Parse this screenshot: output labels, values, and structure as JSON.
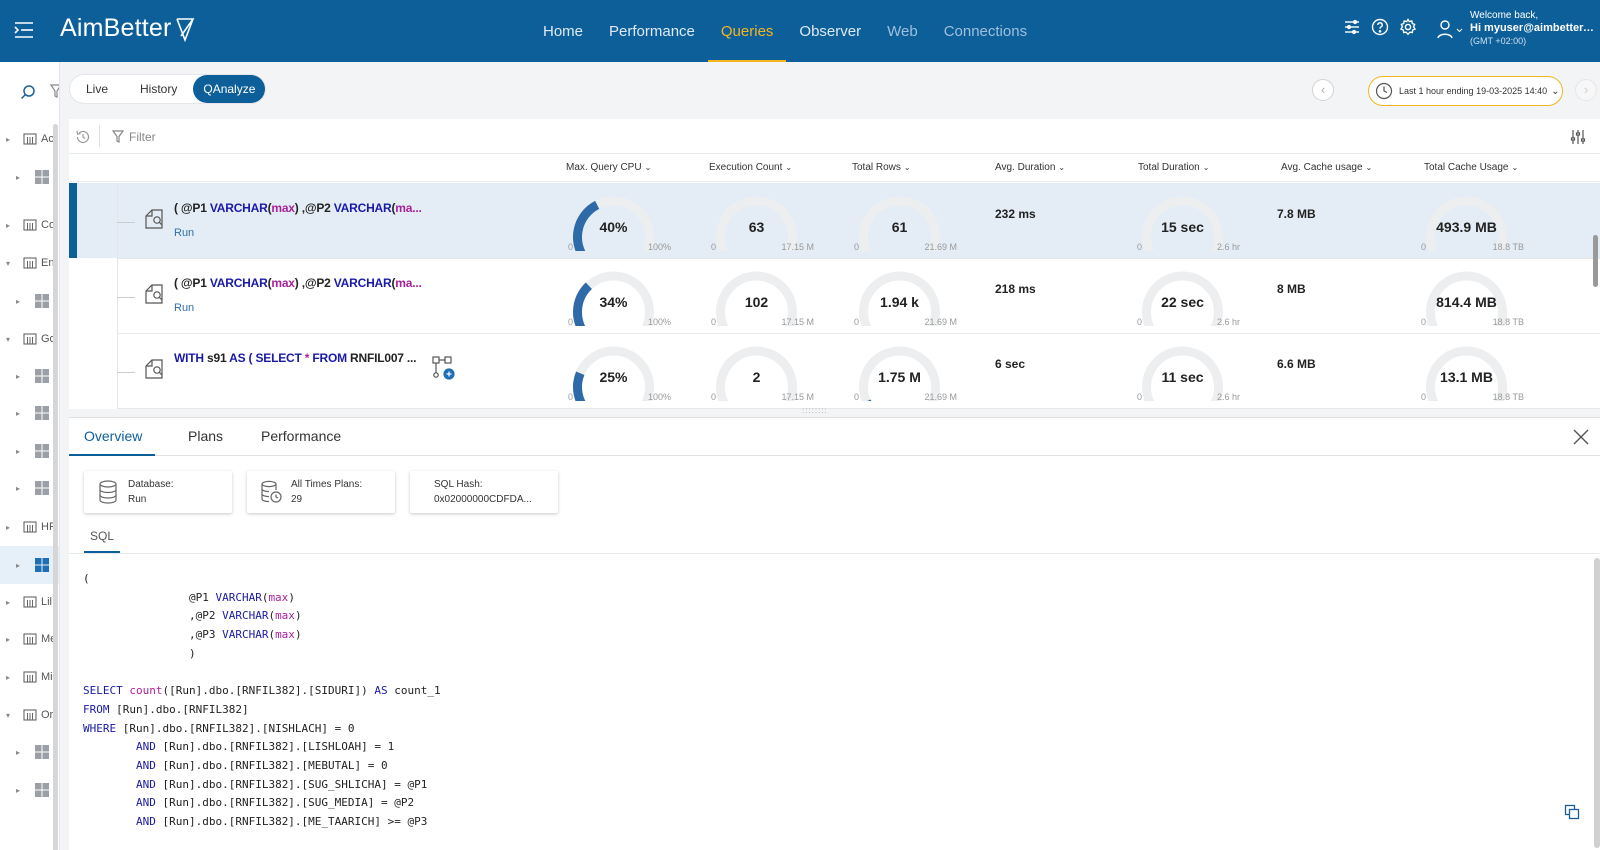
{
  "app": {
    "logo": "AimBetter",
    "nav": [
      "Home",
      "Performance",
      "Queries",
      "Observer",
      "Web",
      "Connections"
    ],
    "active_nav": "Queries",
    "user": {
      "welcome": "Welcome back,",
      "name": "Hi myuser@aimbetter....",
      "timezone": "(GMT +02:00)"
    },
    "accent_color": "#0d5f9a",
    "highlight_color": "#f4b521"
  },
  "sidebar": {
    "items": [
      {
        "label": "Ac",
        "type": "group"
      },
      {
        "label": "",
        "type": "server"
      },
      {
        "label": "Co",
        "type": "group"
      },
      {
        "label": "En",
        "type": "group"
      },
      {
        "label": "",
        "type": "server"
      },
      {
        "label": "Go",
        "type": "group"
      },
      {
        "label": "",
        "type": "server"
      },
      {
        "label": "",
        "type": "server"
      },
      {
        "label": "",
        "type": "server"
      },
      {
        "label": "",
        "type": "server"
      },
      {
        "label": "HF",
        "type": "group"
      },
      {
        "label": "",
        "type": "server",
        "selected": true
      },
      {
        "label": "Lil",
        "type": "group"
      },
      {
        "label": "Me",
        "type": "group"
      },
      {
        "label": "Mil",
        "type": "group"
      },
      {
        "label": "Or",
        "type": "group"
      },
      {
        "label": "",
        "type": "server"
      },
      {
        "label": "",
        "type": "server"
      }
    ]
  },
  "view_tabs": {
    "live": "Live",
    "history": "History",
    "qanalyze": "QAnalyze",
    "active": "QAnalyze"
  },
  "time_range": {
    "label": "Last 1 hour ending",
    "date": "19-03-2025 14:40"
  },
  "filter": {
    "placeholder": "Filter"
  },
  "columns": [
    "Max. Query CPU",
    "Execution Count",
    "Total Rows",
    "Avg. Duration",
    "Total Duration",
    "Avg. Cache usage",
    "Total Cache Usage"
  ],
  "rows": [
    {
      "query_parts": {
        "a": "( @P1 ",
        "b": "VARCHAR",
        "c": "(",
        "d": "max",
        "e": ") ,@P2 ",
        "f": "VARCHAR",
        "g": "(",
        "h": "ma..."
      },
      "run": "Run",
      "cpu": {
        "value": "40%",
        "min": "0",
        "max": "100%",
        "fraction": 0.4
      },
      "exec": {
        "value": "63",
        "min": "0",
        "max": "17.15 M",
        "fraction": 0.02
      },
      "rows": {
        "value": "61",
        "min": "0",
        "max": "21.69 M",
        "fraction": 0.02
      },
      "avg_duration": "232 ms",
      "total_duration": {
        "value": "15 sec",
        "min": "0",
        "max": "2.6 hr",
        "fraction": 0.0
      },
      "avg_cache": "7.8 MB",
      "total_cache": {
        "value": "493.9 MB",
        "min": "0",
        "max": "18.8 TB",
        "fraction": 0.0
      },
      "selected": true
    },
    {
      "query_parts": {
        "a": "( @P1 ",
        "b": "VARCHAR",
        "c": "(",
        "d": "max",
        "e": ") ,@P2 ",
        "f": "VARCHAR",
        "g": "(",
        "h": "ma..."
      },
      "run": "Run",
      "cpu": {
        "value": "34%",
        "min": "0",
        "max": "100%",
        "fraction": 0.34
      },
      "exec": {
        "value": "102",
        "min": "0",
        "max": "17.15 M",
        "fraction": 0.0
      },
      "rows": {
        "value": "1.94 k",
        "min": "0",
        "max": "21.69 M",
        "fraction": 0.0
      },
      "avg_duration": "218 ms",
      "total_duration": {
        "value": "22 sec",
        "min": "0",
        "max": "2.6 hr",
        "fraction": 0.0
      },
      "avg_cache": "8 MB",
      "total_cache": {
        "value": "814.4 MB",
        "min": "0",
        "max": "18.8 TB",
        "fraction": 0.0
      },
      "selected": false
    },
    {
      "query_parts": {
        "a": "WITH ",
        "b": "s91 ",
        "c": "AS ( SELECT ",
        "d": "* ",
        "e": "FROM ",
        "f": "RNFIL007 ...",
        "g": "",
        "h": ""
      },
      "run": "",
      "cpu": {
        "value": "25%",
        "min": "0",
        "max": "100%",
        "fraction": 0.25
      },
      "exec": {
        "value": "2",
        "min": "0",
        "max": "17.15 M",
        "fraction": 0.0
      },
      "rows": {
        "value": "1.75 M",
        "min": "0",
        "max": "21.69 M",
        "fraction": 0.08
      },
      "avg_duration": "6 sec",
      "total_duration": {
        "value": "11 sec",
        "min": "0",
        "max": "2.6 hr",
        "fraction": 0.0
      },
      "avg_cache": "6.6 MB",
      "total_cache": {
        "value": "13.1 MB",
        "min": "0",
        "max": "18.8 TB",
        "fraction": 0.0
      },
      "selected": false
    }
  ],
  "detail": {
    "tabs": [
      "Overview",
      "Plans",
      "Performance"
    ],
    "active_tab": "Overview",
    "cards": [
      {
        "label": "Database:",
        "value": "Run"
      },
      {
        "label": "All Times Plans:",
        "value": "29"
      },
      {
        "label": "SQL Hash:",
        "value": "0x02000000CDFDA..."
      }
    ],
    "sql_tab": "SQL",
    "code_lines": [
      [
        [
          "t",
          "("
        ]
      ],
      [
        [
          "t",
          "                @P1 "
        ],
        [
          "k",
          "VARCHAR"
        ],
        [
          "t",
          "("
        ],
        [
          "f",
          "max"
        ],
        [
          "t",
          ")"
        ]
      ],
      [
        [
          "t",
          "                ,@P2 "
        ],
        [
          "k",
          "VARCHAR"
        ],
        [
          "t",
          "("
        ],
        [
          "f",
          "max"
        ],
        [
          "t",
          ")"
        ]
      ],
      [
        [
          "t",
          "                ,@P3 "
        ],
        [
          "k",
          "VARCHAR"
        ],
        [
          "t",
          "("
        ],
        [
          "f",
          "max"
        ],
        [
          "t",
          ")"
        ]
      ],
      [
        [
          "t",
          "                )"
        ]
      ],
      [
        [
          "t",
          ""
        ]
      ],
      [
        [
          "k",
          "SELECT "
        ],
        [
          "f",
          "count"
        ],
        [
          "t",
          "([Run].dbo.[RNFIL382].[SIDURI]) "
        ],
        [
          "k",
          "AS"
        ],
        [
          "t",
          " count_1"
        ]
      ],
      [
        [
          "k",
          "FROM"
        ],
        [
          "t",
          " [Run].dbo.[RNFIL382]"
        ]
      ],
      [
        [
          "k",
          "WHERE"
        ],
        [
          "t",
          " [Run].dbo.[RNFIL382].[NISHLACH] = 0"
        ]
      ],
      [
        [
          "t",
          "        "
        ],
        [
          "k",
          "AND"
        ],
        [
          "t",
          " [Run].dbo.[RNFIL382].[LISHLOAH] = 1"
        ]
      ],
      [
        [
          "t",
          "        "
        ],
        [
          "k",
          "AND"
        ],
        [
          "t",
          " [Run].dbo.[RNFIL382].[MEBUTAL] = 0"
        ]
      ],
      [
        [
          "t",
          "        "
        ],
        [
          "k",
          "AND"
        ],
        [
          "t",
          " [Run].dbo.[RNFIL382].[SUG_SHLICHA] = @P1"
        ]
      ],
      [
        [
          "t",
          "        "
        ],
        [
          "k",
          "AND"
        ],
        [
          "t",
          " [Run].dbo.[RNFIL382].[SUG_MEDIA] = @P2"
        ]
      ],
      [
        [
          "t",
          "        "
        ],
        [
          "k",
          "AND"
        ],
        [
          "t",
          " [Run].dbo.[RNFIL382].[ME_TAARICH] >= @P3"
        ]
      ]
    ]
  }
}
